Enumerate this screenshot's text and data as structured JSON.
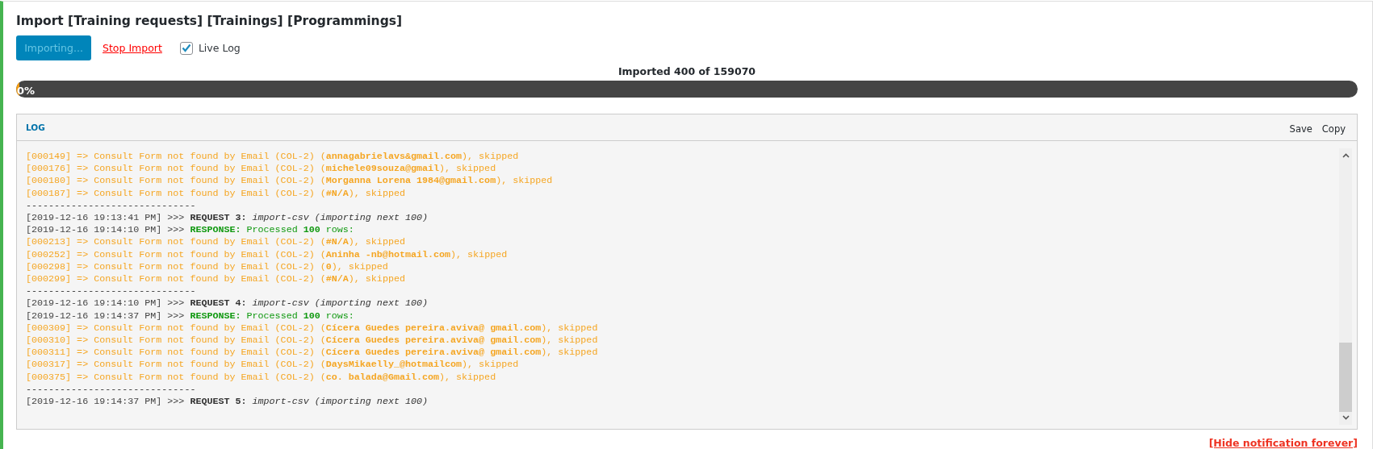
{
  "title": "Import [Training requests] [Trainings] [Programmings]",
  "import_button": {
    "label": "Importing...",
    "disabled": true
  },
  "stop_link": "Stop Import",
  "live_log": {
    "label": "Live Log",
    "checked": true
  },
  "progress": {
    "caption": "Imported 400 of 159070",
    "percent_label": "0%",
    "level": 0.0025
  },
  "log": {
    "title": "LOG",
    "actions": [
      "Save",
      "Copy"
    ],
    "lines": [
      {
        "kind": "entry",
        "text": "[000149] => Consult Form not found by Email (COL-2) (**annagabrielavs&gmail.com**), skipped"
      },
      {
        "kind": "entry",
        "text": "[000176] => Consult Form not found by Email (COL-2) (**michele09souza@gmail**), skipped"
      },
      {
        "kind": "entry",
        "text": "[000180] => Consult Form not found by Email (COL-2) (**Morganna Lorena 1984@gmail.com**), skipped"
      },
      {
        "kind": "entry",
        "text": "[000187] => Consult Form not found by Email (COL-2) (**#N/A**), skipped"
      },
      {
        "kind": "separator",
        "text": "------------------------------"
      },
      {
        "kind": "request",
        "time": "[2019-12-16 19:13:41 PM] >>>",
        "text": "**REQUEST 3:** *import-csv (importing next 100)*"
      },
      {
        "kind": "response",
        "time": "[2019-12-16 19:14:10 PM] >>>",
        "text": "**RESPONSE:** Processed **100** rows:"
      },
      {
        "kind": "entry",
        "text": "[000213] => Consult Form not found by Email (COL-2) (**#N/A**), skipped"
      },
      {
        "kind": "entry",
        "text": "[000252] => Consult Form not found by Email (COL-2) (**Aninha -nb@hotmail.com**), skipped"
      },
      {
        "kind": "entry",
        "text": "[000298] => Consult Form not found by Email (COL-2) (**0**), skipped"
      },
      {
        "kind": "entry",
        "text": "[000299] => Consult Form not found by Email (COL-2) (**#N/A**), skipped"
      },
      {
        "kind": "separator",
        "text": "------------------------------"
      },
      {
        "kind": "request",
        "time": "[2019-12-16 19:14:10 PM] >>>",
        "text": "**REQUEST 4:** *import-csv (importing next 100)*"
      },
      {
        "kind": "response",
        "time": "[2019-12-16 19:14:37 PM] >>>",
        "text": "**RESPONSE:** Processed **100** rows:"
      },
      {
        "kind": "entry",
        "text": "[000309] => Consult Form not found by Email (COL-2) (**Cícera Guedes pereira.aviva@ gmail.com**), skipped"
      },
      {
        "kind": "entry",
        "text": "[000310] => Consult Form not found by Email (COL-2) (**Cícera Guedes pereira.aviva@ gmail.com**), skipped"
      },
      {
        "kind": "entry",
        "text": "[000311] => Consult Form not found by Email (COL-2) (**Cícera Guedes pereira.aviva@ gmail.com**), skipped"
      },
      {
        "kind": "entry",
        "text": "[000317] => Consult Form not found by Email (COL-2) (**DaysMikaelly_@hotmailcom**), skipped"
      },
      {
        "kind": "entry",
        "text": "[000375] => Consult Form not found by Email (COL-2) (**co. balada@Gmail.com**), skipped"
      },
      {
        "kind": "separator",
        "text": "------------------------------"
      },
      {
        "kind": "request",
        "time": "[2019-12-16 19:14:37 PM] >>>",
        "text": "**REQUEST 5:** *import-csv (importing next 100)*"
      }
    ]
  },
  "hide_link": "[Hide notification forever]"
}
